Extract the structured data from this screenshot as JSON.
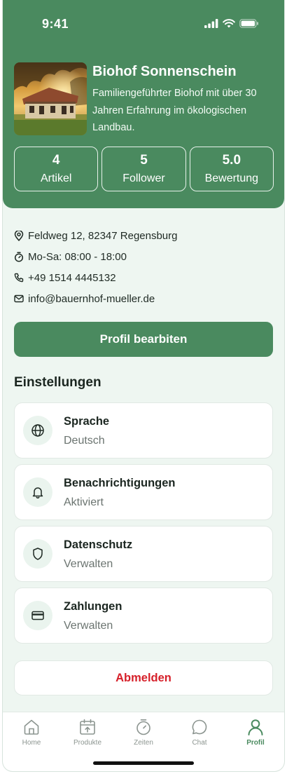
{
  "status_bar": {
    "time": "9:41"
  },
  "profile": {
    "name": "Biohof Sonnenschein",
    "description": "Familiengeführter Biohof mit über 30 Jahren Erfahrung im ökologischen Landbau.",
    "stats": [
      {
        "value": "4",
        "label": "Artikel"
      },
      {
        "value": "5",
        "label": "Follower"
      },
      {
        "value": "5.0",
        "label": "Bewertung"
      }
    ]
  },
  "contact": {
    "address": "Feldweg 12, 82347 Regensburg",
    "hours": "Mo-Sa: 08:00 - 18:00",
    "phone": "+49 1514 4445132",
    "email": "info@bauernhof-mueller.de"
  },
  "edit_button_label": "Profil bearbiten",
  "settings": {
    "title": "Einstellungen",
    "items": [
      {
        "title": "Sprache",
        "value": "Deutsch",
        "icon": "globe-icon"
      },
      {
        "title": "Benachrichtigungen",
        "value": "Aktiviert",
        "icon": "bell-icon"
      },
      {
        "title": "Datenschutz",
        "value": "Verwalten",
        "icon": "shield-icon"
      },
      {
        "title": "Zahlungen",
        "value": "Verwalten",
        "icon": "credit-card-icon"
      }
    ]
  },
  "logout_label": "Abmelden",
  "tabbar": {
    "active": "Profil",
    "tabs": [
      {
        "label": "Home",
        "icon": "home-icon"
      },
      {
        "label": "Produkte",
        "icon": "calendar-upload-icon"
      },
      {
        "label": "Zeiten",
        "icon": "stopwatch-icon"
      },
      {
        "label": "Chat",
        "icon": "chat-bubble-icon"
      },
      {
        "label": "Profil",
        "icon": "user-icon"
      }
    ]
  },
  "colors": {
    "brand": "#4a8a5f",
    "background": "#eef6f1",
    "danger": "#d6202a"
  }
}
